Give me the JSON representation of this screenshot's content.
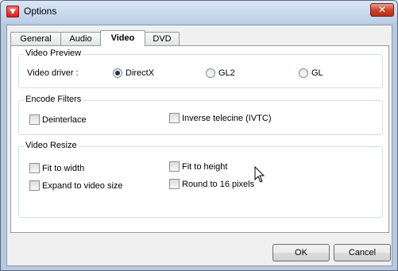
{
  "window": {
    "title": "Options",
    "close_label": "✕"
  },
  "tabs": [
    {
      "label": "General",
      "active": false
    },
    {
      "label": "Audio",
      "active": false
    },
    {
      "label": "Video",
      "active": true
    },
    {
      "label": "DVD",
      "active": false
    }
  ],
  "video_preview": {
    "title": "Video Preview",
    "driver_label": "Video driver :",
    "options": [
      {
        "label": "DirectX",
        "checked": true
      },
      {
        "label": "GL2",
        "checked": false
      },
      {
        "label": "GL",
        "checked": false
      }
    ]
  },
  "encode_filters": {
    "title": "Encode Filters",
    "deinterlace": {
      "label": "Deinterlace",
      "checked": false
    },
    "ivtc": {
      "label": "Inverse telecine (IVTC)",
      "checked": false
    }
  },
  "video_resize": {
    "title": "Video Resize",
    "fit_width": {
      "label": "Fit to width",
      "checked": false
    },
    "fit_height": {
      "label": "Fit to height",
      "checked": false
    },
    "expand": {
      "label": "Expand to video size",
      "checked": false
    },
    "round16": {
      "label": "Round to 16 pixels",
      "checked": false
    }
  },
  "buttons": {
    "ok": "OK",
    "cancel": "Cancel"
  }
}
